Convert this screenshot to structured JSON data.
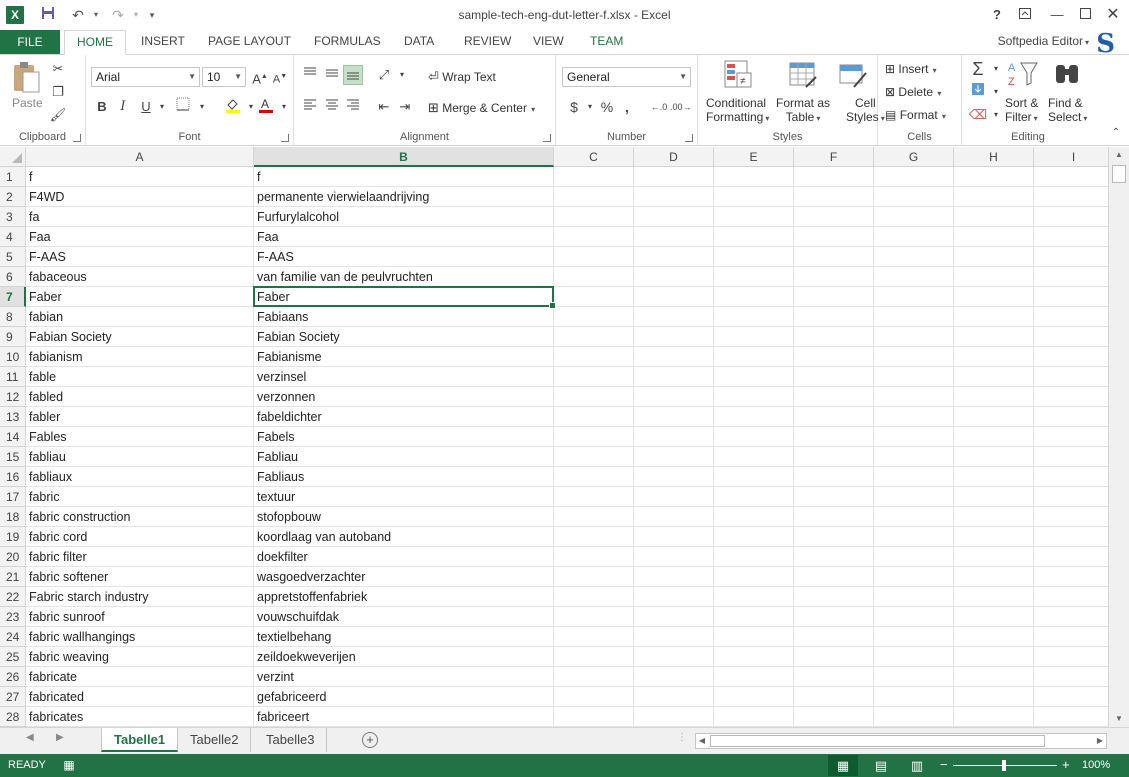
{
  "window": {
    "title": "sample-tech-eng-dut-letter-f.xlsx - Excel",
    "app_icon": "X",
    "help": "?",
    "account": "Softpedia Editor",
    "account_logo": "S"
  },
  "ribbon_tabs": [
    "FILE",
    "HOME",
    "INSERT",
    "PAGE LAYOUT",
    "FORMULAS",
    "DATA",
    "REVIEW",
    "VIEW",
    "TEAM"
  ],
  "ribbon": {
    "clipboard": {
      "label": "Clipboard",
      "paste": "Paste"
    },
    "font": {
      "label": "Font",
      "name": "Arial",
      "size": "10",
      "bold": "B",
      "italic": "I",
      "underline": "U",
      "grow": "A",
      "shrink": "A"
    },
    "alignment": {
      "label": "Alignment",
      "wrap_text": "Wrap Text",
      "merge_center": "Merge & Center"
    },
    "number": {
      "label": "Number",
      "format": "General",
      "currency": "$",
      "percent": "%",
      "comma": ","
    },
    "styles": {
      "label": "Styles",
      "conditional_1": "Conditional",
      "conditional_2": "Formatting",
      "format_table_1": "Format as",
      "format_table_2": "Table",
      "cell_styles_1": "Cell",
      "cell_styles_2": "Styles"
    },
    "cells": {
      "label": "Cells",
      "insert": "Insert",
      "delete": "Delete",
      "format": "Format"
    },
    "editing": {
      "label": "Editing",
      "sort_1": "Sort &",
      "sort_2": "Filter",
      "find_1": "Find &",
      "find_2": "Select"
    }
  },
  "columns": [
    "A",
    "B",
    "C",
    "D",
    "E",
    "F",
    "G",
    "H",
    "I"
  ],
  "selected_column": "B",
  "selected_row": 7,
  "rows": [
    {
      "n": "1",
      "a": "f",
      "b": "f"
    },
    {
      "n": "2",
      "a": "F4WD",
      "b": "permanente vierwielaandrijving"
    },
    {
      "n": "3",
      "a": "fa",
      "b": "Furfurylalcohol"
    },
    {
      "n": "4",
      "a": "Faa",
      "b": "Faa"
    },
    {
      "n": "5",
      "a": "F-AAS",
      "b": "F-AAS"
    },
    {
      "n": "6",
      "a": "fabaceous",
      "b": "van familie van de peulvruchten"
    },
    {
      "n": "7",
      "a": "Faber",
      "b": "Faber"
    },
    {
      "n": "8",
      "a": "fabian",
      "b": "Fabiaans"
    },
    {
      "n": "9",
      "a": "Fabian Society",
      "b": "Fabian Society"
    },
    {
      "n": "10",
      "a": "fabianism",
      "b": "Fabianisme"
    },
    {
      "n": "11",
      "a": "fable",
      "b": "verzinsel"
    },
    {
      "n": "12",
      "a": "fabled",
      "b": "verzonnen"
    },
    {
      "n": "13",
      "a": "fabler",
      "b": "fabeldichter"
    },
    {
      "n": "14",
      "a": "Fables",
      "b": "Fabels"
    },
    {
      "n": "15",
      "a": "fabliau",
      "b": "Fabliau"
    },
    {
      "n": "16",
      "a": "fabliaux",
      "b": "Fabliaus"
    },
    {
      "n": "17",
      "a": "fabric",
      "b": "textuur"
    },
    {
      "n": "18",
      "a": "fabric construction",
      "b": "stofopbouw"
    },
    {
      "n": "19",
      "a": "fabric cord",
      "b": "koordlaag van autoband"
    },
    {
      "n": "20",
      "a": "fabric filter",
      "b": "doekfilter"
    },
    {
      "n": "21",
      "a": "fabric softener",
      "b": "wasgoedverzachter"
    },
    {
      "n": "22",
      "a": "Fabric starch industry",
      "b": "appretstoffenfabriek"
    },
    {
      "n": "23",
      "a": "fabric sunroof",
      "b": "vouwschuifdak"
    },
    {
      "n": "24",
      "a": "fabric wallhangings",
      "b": "textielbehang"
    },
    {
      "n": "25",
      "a": "fabric weaving",
      "b": "zeildoekweverijen"
    },
    {
      "n": "26",
      "a": "fabricate",
      "b": "verzint"
    },
    {
      "n": "27",
      "a": "fabricated",
      "b": "gefabriceerd"
    },
    {
      "n": "28",
      "a": "fabricates",
      "b": "fabriceert"
    }
  ],
  "sheets": [
    "Tabelle1",
    "Tabelle2",
    "Tabelle3"
  ],
  "active_sheet": "Tabelle1",
  "status": {
    "text": "READY",
    "zoom": "100%"
  },
  "colors": {
    "accent": "#217346",
    "selection_header": "#e1e1e1"
  }
}
